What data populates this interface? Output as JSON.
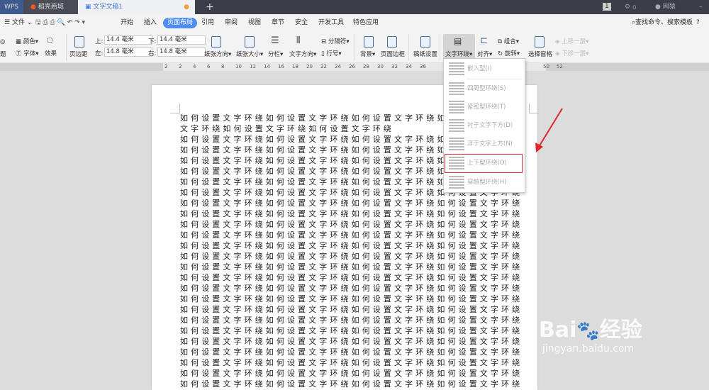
{
  "titlebar": {
    "tabs": [
      "WPS",
      "稻壳商城",
      "文字文稿1"
    ],
    "badge": "1",
    "user": "网猿",
    "new_tab": "+"
  },
  "menubar": {
    "file": "文件",
    "items": [
      "开始",
      "插入",
      "页面布局",
      "引用",
      "审阅",
      "视图",
      "章节",
      "安全",
      "开发工具",
      "特色应用"
    ],
    "active": "页面布局",
    "search": "查找命令、搜索模板",
    "help": "?"
  },
  "ribbon": {
    "theme": "题",
    "color": "颜色",
    "font": "字体",
    "effect": "效果",
    "margins": "页边距",
    "top_label": "上:",
    "top": "14.4 毫米",
    "bottom_label": "下:",
    "bottom": "14.4 毫米",
    "left_label": "左:",
    "left": "14.8 毫米",
    "right_label": "右:",
    "right": "14.8 毫米",
    "orientation": "纸张方向",
    "size": "纸张大小",
    "columns": "分栏",
    "text_dir": "文字方向",
    "separator": "分隔符",
    "line_num": "行号",
    "background": "背景",
    "border": "页面边框",
    "draft": "稿纸设置",
    "wrap": "文字环绕",
    "align": "对齐",
    "group": "组合",
    "rotate": "旋转",
    "pane": "选择窗格",
    "forward": "上移一层",
    "backward": "下移一层"
  },
  "ruler": {
    "ticks": [
      "2",
      "2",
      "4",
      "6",
      "8",
      "10",
      "12",
      "14",
      "16",
      "18",
      "20",
      "22",
      "24",
      "26",
      "28",
      "30",
      "32",
      "34",
      "36",
      "50",
      "52"
    ]
  },
  "document": {
    "lines": [
      "如何设置文字环绕如何设置文字环绕如何设置文字环绕如何设置",
      "文字环绕如何设置文字环绕如何设置文字环绕"
    ],
    "repeat_line": "如何设置文字环绕如何设置文字环绕如何设置文字环绕如何设置文字环绕"
  },
  "dropdown": {
    "items": [
      "嵌入型(I)",
      "四周型环绕(S)",
      "紧密型环绕(T)",
      "衬于文字下方(D)",
      "浮于文字上方(N)",
      "上下型环绕(O)",
      "穿越型环绕(H)"
    ],
    "highlighted": "上下型环绕(O)"
  },
  "watermark": {
    "brand": "Baidu经验",
    "url": "jingyan.baidu.com"
  },
  "colors": {
    "accent": "#4f8ef0",
    "highlight": "#e3262b"
  }
}
